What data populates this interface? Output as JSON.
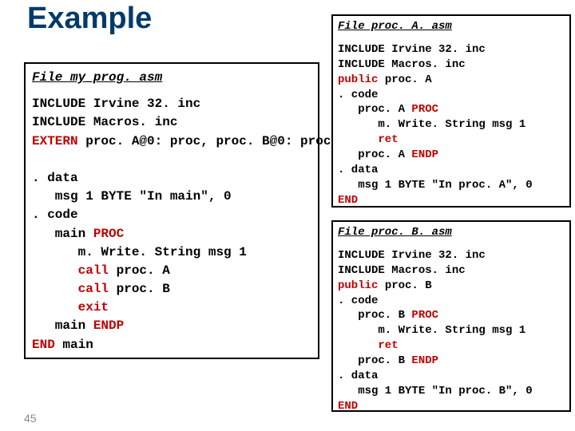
{
  "title": "Example",
  "pagenum": "45",
  "left": {
    "filename": "File my_prog. asm",
    "l1": "INCLUDE Irvine 32. inc",
    "l2": "INCLUDE Macros. inc",
    "l3a": "EXTERN",
    "l3b": " proc. A@0: proc, proc. B@0: proc",
    "l4": ". data",
    "l5": "   msg 1 BYTE \"In main\", 0",
    "l6": ". code",
    "l7a": "   main ",
    "l7b": "PROC",
    "l8": "      m. Write. String msg 1",
    "l9a": "      call",
    "l9b": " proc. A",
    "l10a": "      call",
    "l10b": " proc. B",
    "l11a": "      exit",
    "l12a": "   main ",
    "l12b": "ENDP",
    "l13a": "END",
    "l13b": " main"
  },
  "ra": {
    "filename": "File proc. A. asm",
    "l1": "INCLUDE Irvine 32. inc",
    "l2": "INCLUDE Macros. inc",
    "l3a": "public",
    "l3b": " proc. A",
    "l4": ". code",
    "l5a": "   proc. A ",
    "l5b": "PROC",
    "l6": "      m. Write. String msg 1",
    "l7a": "      ret",
    "l8a": "   proc. A ",
    "l8b": "ENDP",
    "l9": ". data",
    "l10": "   msg 1 BYTE \"In proc. A\", 0",
    "l11a": "END"
  },
  "rb": {
    "filename": "File proc. B. asm",
    "l1": "INCLUDE Irvine 32. inc",
    "l2": "INCLUDE Macros. inc",
    "l3a": "public",
    "l3b": " proc. B",
    "l4": ". code",
    "l5a": "   proc. B ",
    "l5b": "PROC",
    "l6": "      m. Write. String msg 1",
    "l7a": "      ret",
    "l8a": "   proc. B ",
    "l8b": "ENDP",
    "l9": ". data",
    "l10": "   msg 1 BYTE \"In proc. B\", 0",
    "l11a": "END"
  }
}
